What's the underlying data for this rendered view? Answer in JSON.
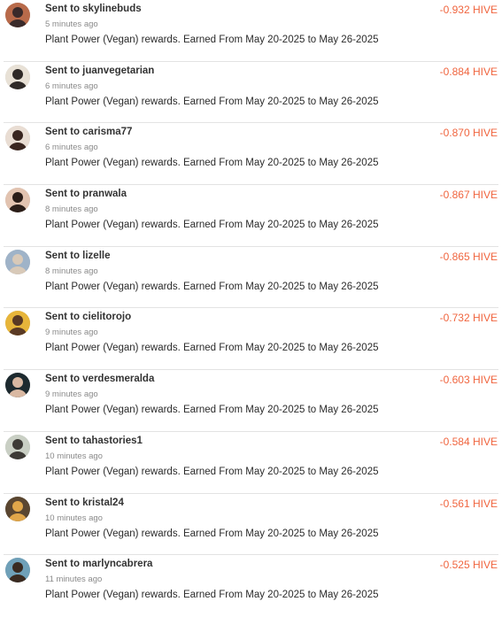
{
  "colors": {
    "amount": "#f0653f",
    "divider": "#e3e3e3",
    "muted": "#8a8a8a"
  },
  "transfers": [
    {
      "title": "Sent to skylinebuds",
      "time": "5 minutes ago",
      "memo": "Plant Power (Vegan) rewards. Earned From May 20-2025 to May 26-2025",
      "amount": "-0.932 HIVE",
      "avatar_icon": "avatar-icon",
      "avatar_bg": "#b86a4a",
      "avatar_fg": "#3a2a2a"
    },
    {
      "title": "Sent to juanvegetarian",
      "time": "6 minutes ago",
      "memo": "Plant Power (Vegan) rewards. Earned From May 20-2025 to May 26-2025",
      "amount": "-0.884 HIVE",
      "avatar_icon": "avatar-icon",
      "avatar_bg": "#e8e1d6",
      "avatar_fg": "#2f2a28"
    },
    {
      "title": "Sent to carisma77",
      "time": "6 minutes ago",
      "memo": "Plant Power (Vegan) rewards. Earned From May 20-2025 to May 26-2025",
      "amount": "-0.870 HIVE",
      "avatar_icon": "avatar-icon",
      "avatar_bg": "#e9ddd3",
      "avatar_fg": "#3a2620"
    },
    {
      "title": "Sent to pranwala",
      "time": "8 minutes ago",
      "memo": "Plant Power (Vegan) rewards. Earned From May 20-2025 to May 26-2025",
      "amount": "-0.867 HIVE",
      "avatar_icon": "avatar-icon",
      "avatar_bg": "#e2c3b0",
      "avatar_fg": "#2a1d18"
    },
    {
      "title": "Sent to lizelle",
      "time": "8 minutes ago",
      "memo": "Plant Power (Vegan) rewards. Earned From May 20-2025 to May 26-2025",
      "amount": "-0.865 HIVE",
      "avatar_icon": "avatar-icon",
      "avatar_bg": "#9fb3c8",
      "avatar_fg": "#d8c9b8"
    },
    {
      "title": "Sent to cielitorojo",
      "time": "9 minutes ago",
      "memo": "Plant Power (Vegan) rewards. Earned From May 20-2025 to May 26-2025",
      "amount": "-0.732 HIVE",
      "avatar_icon": "avatar-icon",
      "avatar_bg": "#e7b53a",
      "avatar_fg": "#5a3a24"
    },
    {
      "title": "Sent to verdesmeralda",
      "time": "9 minutes ago",
      "memo": "Plant Power (Vegan) rewards. Earned From May 20-2025 to May 26-2025",
      "amount": "-0.603 HIVE",
      "avatar_icon": "avatar-icon",
      "avatar_bg": "#1d2a2f",
      "avatar_fg": "#d9b8a2"
    },
    {
      "title": "Sent to tahastories1",
      "time": "10 minutes ago",
      "memo": "Plant Power (Vegan) rewards. Earned From May 20-2025 to May 26-2025",
      "amount": "-0.584 HIVE",
      "avatar_icon": "avatar-icon",
      "avatar_bg": "#c9cfc4",
      "avatar_fg": "#3d3a36"
    },
    {
      "title": "Sent to kristal24",
      "time": "10 minutes ago",
      "memo": "Plant Power (Vegan) rewards. Earned From May 20-2025 to May 26-2025",
      "amount": "-0.561 HIVE",
      "avatar_icon": "avatar-icon",
      "avatar_bg": "#5a4630",
      "avatar_fg": "#e0a64a"
    },
    {
      "title": "Sent to marlyncabrera",
      "time": "11 minutes ago",
      "memo": "Plant Power (Vegan) rewards. Earned From May 20-2025 to May 26-2025",
      "amount": "-0.525 HIVE",
      "avatar_icon": "avatar-icon",
      "avatar_bg": "#6fa0b8",
      "avatar_fg": "#3a2a20"
    }
  ]
}
